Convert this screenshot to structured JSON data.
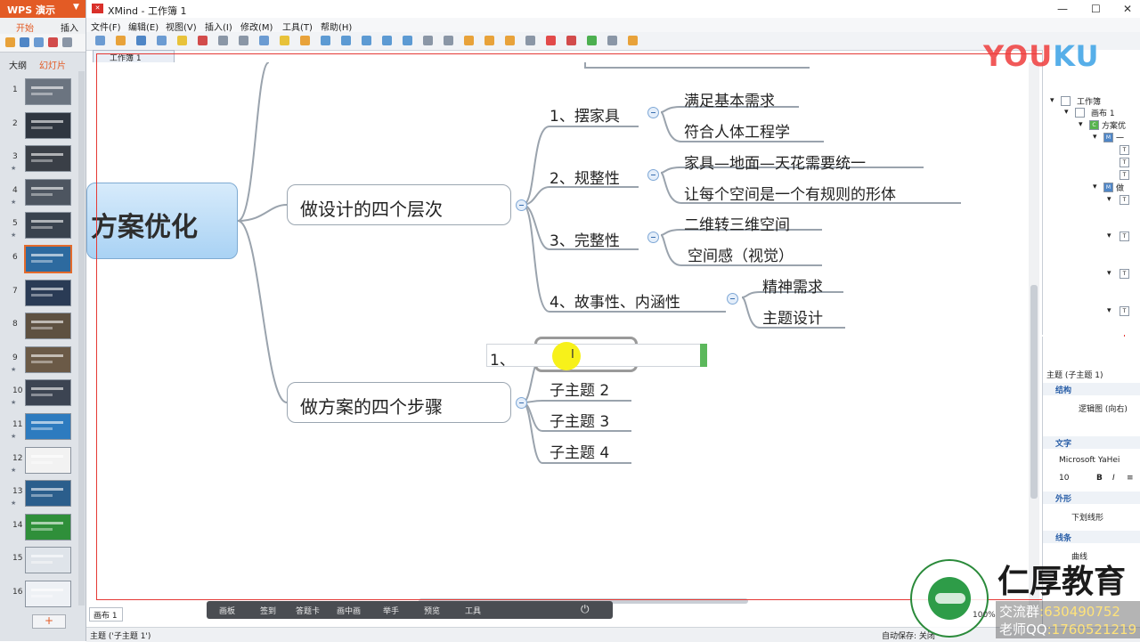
{
  "wps": {
    "app_title": "WPS 演示",
    "tabs": [
      "开始",
      "插入"
    ],
    "view_tabs": [
      "大纲",
      "幻灯片"
    ],
    "slides": [
      {
        "num": "1",
        "star": ""
      },
      {
        "num": "2",
        "star": ""
      },
      {
        "num": "3",
        "star": "★"
      },
      {
        "num": "4",
        "star": "★"
      },
      {
        "num": "5",
        "star": "★"
      },
      {
        "num": "6",
        "star": ""
      },
      {
        "num": "7",
        "star": ""
      },
      {
        "num": "8",
        "star": ""
      },
      {
        "num": "9",
        "star": "★"
      },
      {
        "num": "10",
        "star": "★"
      },
      {
        "num": "11",
        "star": "★"
      },
      {
        "num": "12",
        "star": "★"
      },
      {
        "num": "13",
        "star": "★"
      },
      {
        "num": "14",
        "star": ""
      },
      {
        "num": "15",
        "star": ""
      },
      {
        "num": "16",
        "star": ""
      }
    ],
    "selected_slide": "6",
    "add_label": "+"
  },
  "xmind": {
    "window_title": "XMind - 工作簿 1",
    "menu": [
      "文件(F)",
      "编辑(E)",
      "视图(V)",
      "插入(I)",
      "修改(M)",
      "工具(T)",
      "帮助(H)"
    ],
    "editor_tab": "工作簿 1",
    "window_controls": [
      "—",
      "☐",
      "✕"
    ]
  },
  "mindmap": {
    "central": "方案优化",
    "main_topics": [
      "做设计的四个层次",
      "做方案的四个步骤"
    ],
    "level_groups": [
      {
        "label": "1、摆家具",
        "children": [
          "满足基本需求",
          "符合人体工程学"
        ]
      },
      {
        "label": "2、规整性",
        "children": [
          "家具—地面—天花需要统一",
          "让每个空间是一个有规则的形体"
        ]
      },
      {
        "label": "3、完整性",
        "children": [
          "二维转三维空间",
          "空间感（视觉）"
        ]
      },
      {
        "label": "4、故事性、内涵性",
        "children": [
          "精神需求",
          "主题设计"
        ]
      }
    ],
    "editing_text": "1、",
    "step_subtopics": [
      "子主题 2",
      "子主题 3",
      "子主题 4"
    ]
  },
  "floating_toolbar": [
    "画板",
    "签到",
    "答题卡",
    "画中画",
    "举手",
    "预览",
    "工具"
  ],
  "page_tab": "画布 1",
  "status": {
    "left": "主题 ('子主题 1')",
    "right": "自动保存: 关闭"
  },
  "outline": {
    "root": "工作簿",
    "sheet": "画布 1",
    "central_abbrev": "方案优",
    "m1": "一",
    "m2": "做"
  },
  "properties": {
    "header": "主题 (子主题 1)",
    "sections": {
      "structure": "结构",
      "structure_value": "逻辑图 (向右)",
      "text": "文字",
      "font_name": "Microsoft YaHei",
      "font_size": "10",
      "shape": "外形",
      "shape_value": "下划线形",
      "line": "线条",
      "line_value": "曲线"
    }
  },
  "watermark": {
    "logo_you": "YOU",
    "logo_ku": "KU",
    "brand": "仁厚教育",
    "group_label": "交流群",
    "group_number": ":630490752",
    "teacher_label": "老师QQ",
    "teacher_number": ":1760521219",
    "zoom": "100%"
  }
}
